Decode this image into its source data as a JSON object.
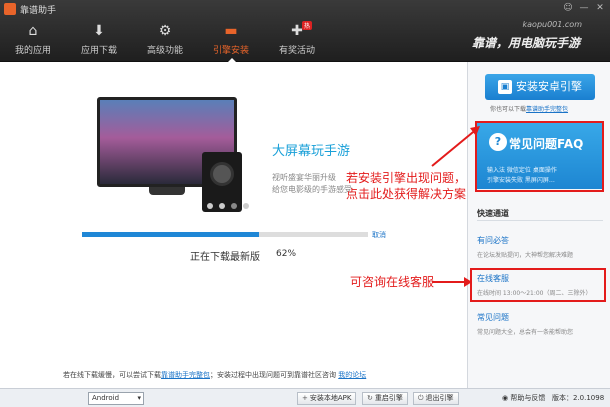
{
  "app": {
    "title": "靠谱助手",
    "site_url": "kaopu001.com",
    "slogan": "靠谱，用电脑玩手游",
    "window_controls": [
      "☺",
      "—",
      "✕"
    ]
  },
  "nav": {
    "items": [
      {
        "label": "我的应用",
        "icon": "home-icon",
        "glyph": "⌂",
        "active": false
      },
      {
        "label": "应用下载",
        "icon": "download-box-icon",
        "glyph": "⬇",
        "active": false
      },
      {
        "label": "高级功能",
        "icon": "gears-icon",
        "glyph": "⚙",
        "active": false
      },
      {
        "label": "引擎安装",
        "icon": "engine-icon",
        "glyph": "▬",
        "active": true
      },
      {
        "label": "有奖活动",
        "icon": "gift-icon",
        "glyph": "✚",
        "active": false,
        "badge": "热"
      }
    ]
  },
  "banner": {
    "title": "大屏幕玩手游",
    "line1": "视听盛宴华丽升级",
    "line2": "给您电影级的手游感受",
    "active_dot": 3,
    "dot_count": 4
  },
  "download": {
    "progress": 0.62,
    "cancel_label": "取消",
    "status": "正在下载最新版",
    "percent": "62%"
  },
  "note": {
    "text1": "若在线下载缓慢，可以尝试下载",
    "link1": "靠谱助手完整包",
    "text2": "；安装过程中出现问题可到靠谱社区咨询",
    "link2": "我的论坛"
  },
  "annotations": {
    "faq_line1": "若安装引擎出现问题，",
    "faq_line2": "点击此处获得解决方案",
    "service": "可咨询在线客服"
  },
  "sidebar": {
    "install_label": "安装安卓引擎",
    "also_text": "你也可以下载",
    "also_link": "靠谱助手完整包",
    "faq_title": "常见问题FAQ",
    "faq_line1": "输入法  微信定位  桌面操作",
    "faq_line2": "引擎安装失败  黑屏闪屏…",
    "quick_title": "快速通道",
    "quick": [
      {
        "title": "有问必答",
        "desc": "在论坛发贴提问，大神帮您解决难题"
      },
      {
        "title": "在线客服",
        "desc": "在线时间 13:00～21:00（周二、三除外）"
      },
      {
        "title": "常见问题",
        "desc": "常见问题大全，总会有一条能帮助您"
      }
    ]
  },
  "bottom": {
    "os_value": "Android",
    "btn_local": "安装本地APK",
    "btn_restart": "重启引擎",
    "btn_exit": "退出引擎",
    "help": "帮助与反馈",
    "version": "版本：2.0.1098"
  },
  "colors": {
    "accent": "#e8642a",
    "blue": "#1f87d6",
    "annotation": "#e31b1b"
  }
}
